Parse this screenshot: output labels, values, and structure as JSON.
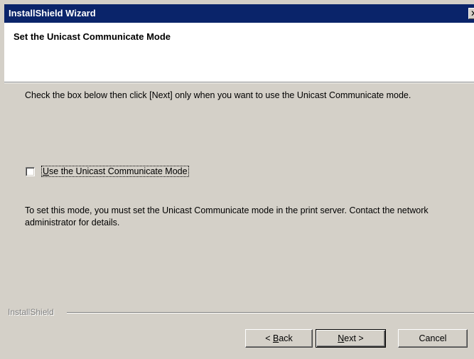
{
  "window": {
    "title": "InstallShield Wizard",
    "close_glyph": "✕"
  },
  "header": {
    "title": "Set the Unicast Communicate Mode"
  },
  "body": {
    "instructions": "Check the box below then click [Next] only when you want to use the Unicast Communicate mode.",
    "checkbox": {
      "label_underlined": "U",
      "label_rest": "se the Unicast Communicate Mode",
      "checked": false
    },
    "note": "To set this mode, you must set the Unicast Communicate mode in the print server. Contact the network administrator for details."
  },
  "footer": {
    "brand": "InstallShield"
  },
  "buttons": {
    "back_prefix": "< ",
    "back_underlined": "B",
    "back_rest": "ack",
    "next_underlined": "N",
    "next_rest": "ext >",
    "cancel": "Cancel"
  },
  "colors": {
    "titlebar": "#0a246a",
    "face": "#d4d0c8",
    "header_bg": "#ffffff"
  },
  "icons": {
    "close": "close-icon"
  }
}
